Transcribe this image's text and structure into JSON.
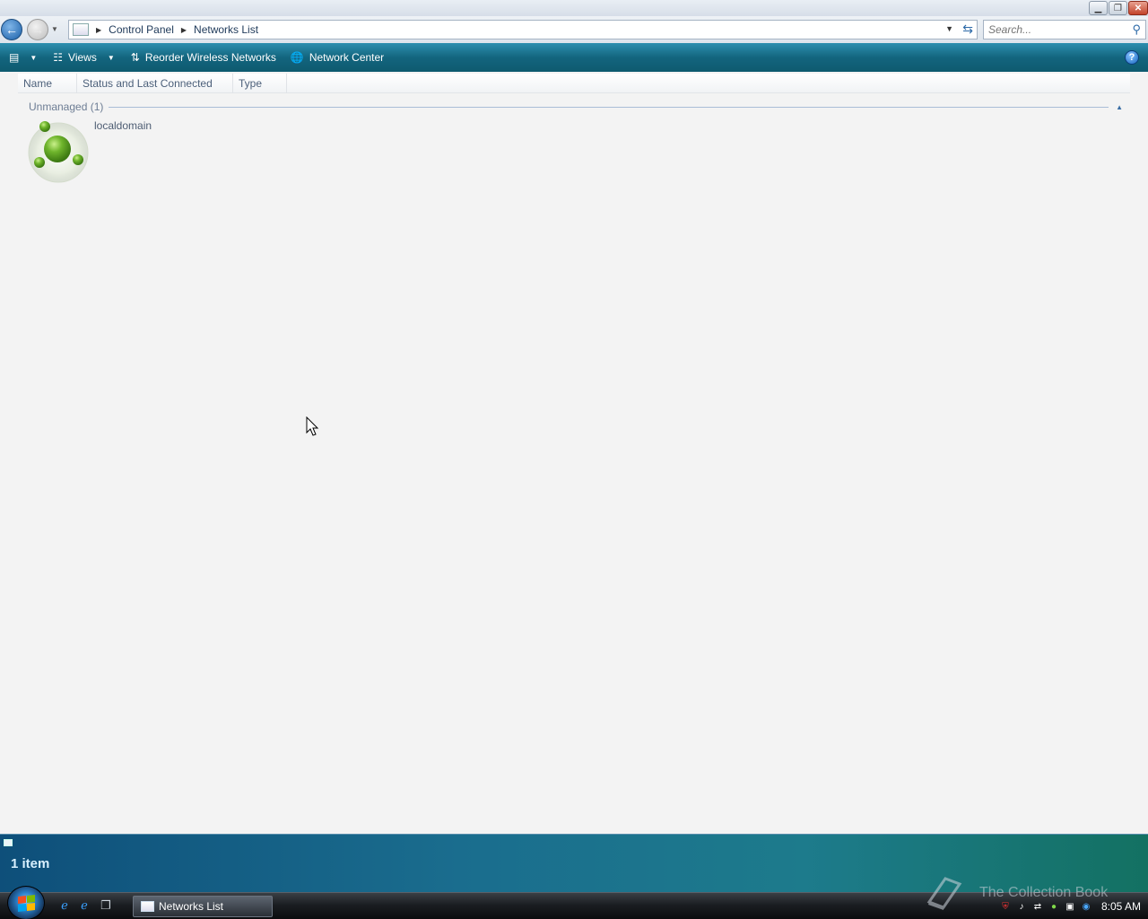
{
  "window": {
    "caption_buttons": {
      "minimize": "▁",
      "maximize": "❐",
      "close": "✕"
    }
  },
  "address": {
    "breadcrumbs": [
      "Control Panel",
      "Networks List"
    ],
    "search_placeholder": "Search..."
  },
  "toolbar": {
    "views_label": "Views",
    "reorder_label": "Reorder Wireless Networks",
    "network_center_label": "Network Center",
    "help_label": "?"
  },
  "columns": [
    "Name",
    "Status and Last Connected",
    "Type"
  ],
  "group": {
    "label": "Unmanaged (1)",
    "items": [
      {
        "name": "localdomain",
        "icon": "network-globe-icon"
      }
    ]
  },
  "details_pane": {
    "item_count": "1 item"
  },
  "taskbar": {
    "quick_launch": [
      "internet-explorer-icon",
      "internet-explorer-icon",
      "switch-windows-icon"
    ],
    "task_label": "Networks List",
    "clock": "8:05 AM",
    "watermark": "The Collection Book"
  },
  "colors": {
    "command_bar": "#13657e",
    "details_pane": "#1a6d8e",
    "network_icon_green": "#6fb52c"
  }
}
